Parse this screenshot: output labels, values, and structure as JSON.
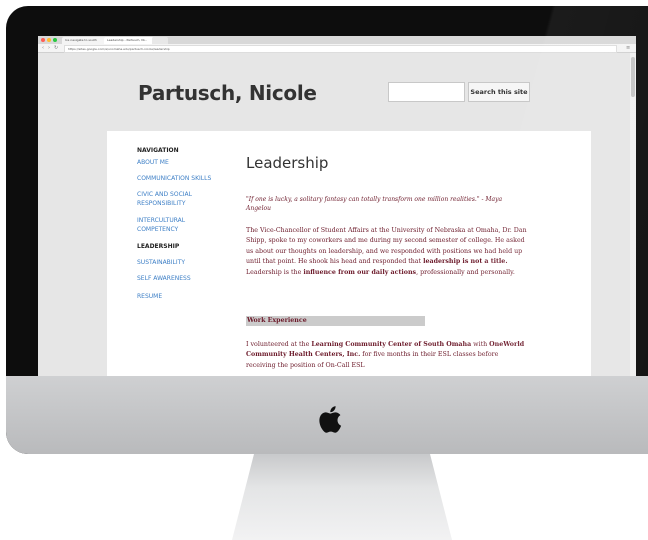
{
  "browser": {
    "tabs": [
      {
        "label": "Ice navigate to south"
      },
      {
        "label": "Leadership - Partusch, Ni..."
      }
    ],
    "url": "https://sites.google.com/a/unomaha.edu/partusch-nicole/leadership",
    "traffic_colors": [
      "#ff5f57",
      "#febc2e",
      "#28c840"
    ]
  },
  "site": {
    "title": "Partusch, Nicole",
    "search_button": "Search this site"
  },
  "nav": {
    "heading": "NAVIGATION",
    "items": [
      {
        "label": "ABOUT ME"
      },
      {
        "label": "COMMUNICATION SKILLS"
      },
      {
        "label": "CIVIC AND SOCIAL RESPONSIBILITY"
      },
      {
        "label": "INTERCULTURAL COMPETENCY"
      },
      {
        "label": "LEADERSHIP"
      },
      {
        "label": "SUSTAINABILITY"
      },
      {
        "label": "SELF AWARENESS"
      },
      {
        "label": "RESUME"
      }
    ]
  },
  "page": {
    "heading": "Leadership",
    "quote": "\"If one is lucky, a solitary fantasy can totally transform one million realities.\" - Maya Angelou",
    "para1": {
      "text1": "The Vice-Chancellor of Student Affairs at the University of Nebraska at Omaha, Dr. Dan Shipp, spoke to my coworkers and me during my second semester of college. He asked us about our thoughts on leadership, and we responded with positions we had held up until that point. He shook his head and responded that ",
      "bold1": "leadership is not a title.",
      "text2": " Leadership is the ",
      "bold2": "influence from our daily actions",
      "text3": ", professionally and personally."
    },
    "section": "Work Experience",
    "para2": {
      "text1": "I volunteered at the ",
      "bold1": "Learning Community Center of South Omaha",
      "text2": " with ",
      "bold2": "OneWorld Community Health Centers, Inc.",
      "text3": " for five months in their ESL classes before receiving the position of On-Call ESL"
    }
  }
}
